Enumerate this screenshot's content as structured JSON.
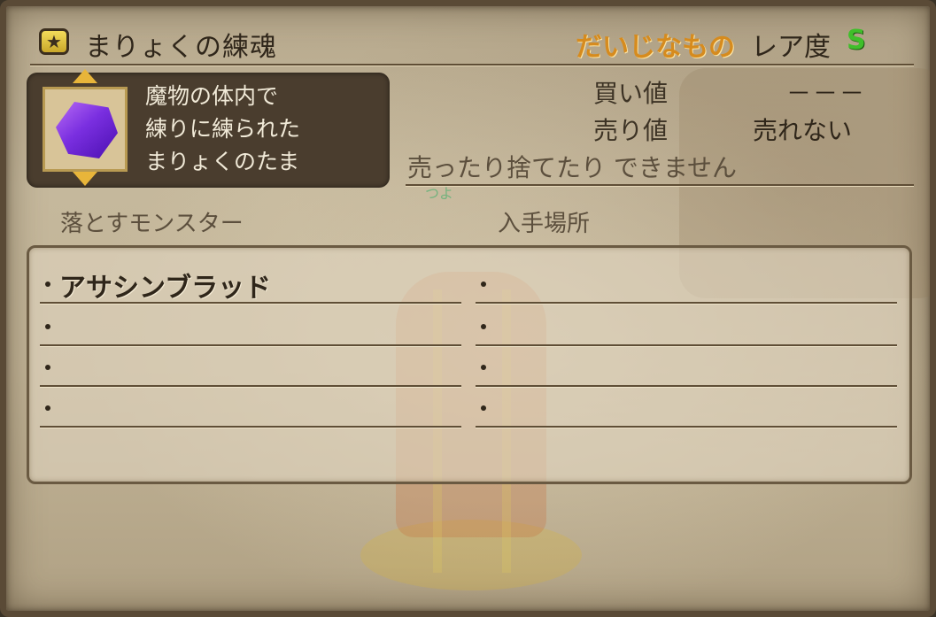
{
  "header": {
    "title": "まりょくの練魂",
    "category": "だいじなもの",
    "rarity_label": "レア度",
    "rarity_value": "S",
    "star_icon": "star-icon"
  },
  "item": {
    "description_lines": [
      "魔物の体内で",
      "練りに練られた",
      "まりょくのたま"
    ],
    "icon": "purple-gem-icon"
  },
  "price": {
    "buy_label": "買い値",
    "buy_value": "－－－",
    "sell_label": "売り値",
    "sell_value": "売れない",
    "note": "売ったり捨てたり できません"
  },
  "background_tag": "つよ",
  "columns": {
    "monster_header": "落とすモンスター",
    "place_header": "入手場所"
  },
  "drop_list": {
    "monsters": [
      "アサシンブラッド",
      "",
      "",
      ""
    ],
    "places": [
      "",
      "",
      "",
      ""
    ]
  },
  "colors": {
    "category": "#d68b1e",
    "rarity": "#3fbf2a",
    "gem": "#7a2fe0"
  }
}
